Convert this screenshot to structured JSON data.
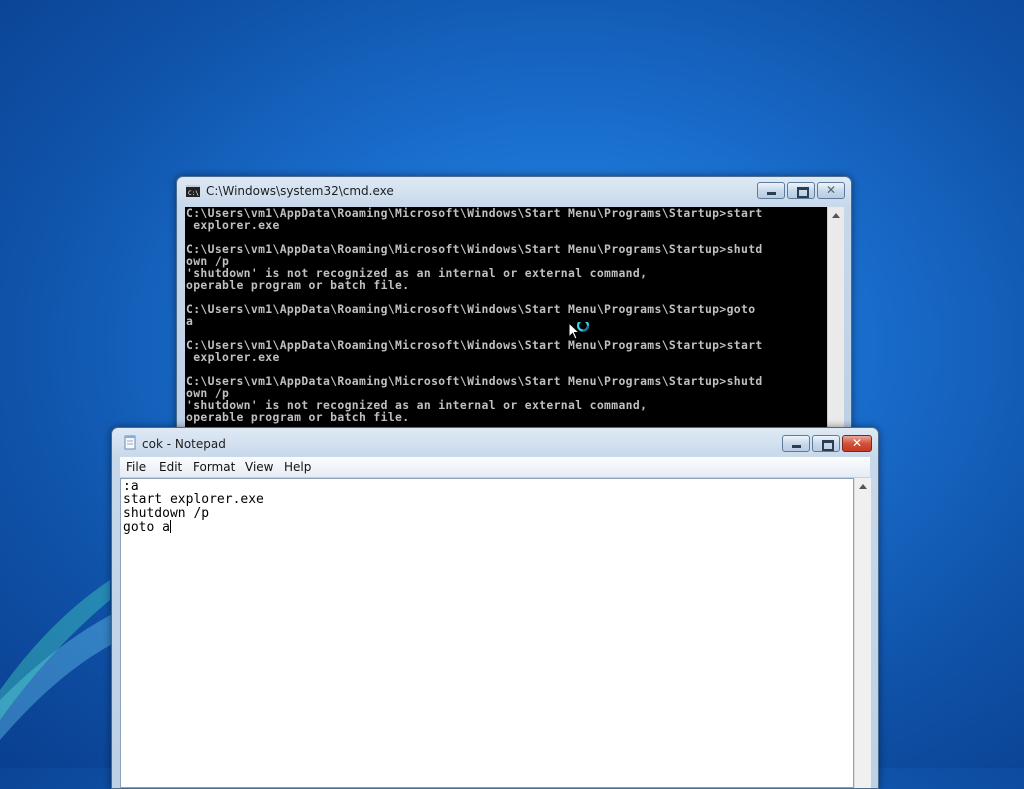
{
  "cmd": {
    "title": "C:\\Windows\\system32\\cmd.exe",
    "lines": "C:\\Users\\vm1\\AppData\\Roaming\\Microsoft\\Windows\\Start Menu\\Programs\\Startup>start\n explorer.exe\n\nC:\\Users\\vm1\\AppData\\Roaming\\Microsoft\\Windows\\Start Menu\\Programs\\Startup>shutd\nown /p\n'shutdown' is not recognized as an internal or external command,\noperable program or batch file.\n\nC:\\Users\\vm1\\AppData\\Roaming\\Microsoft\\Windows\\Start Menu\\Programs\\Startup>goto\na\n\nC:\\Users\\vm1\\AppData\\Roaming\\Microsoft\\Windows\\Start Menu\\Programs\\Startup>start\n explorer.exe\n\nC:\\Users\\vm1\\AppData\\Roaming\\Microsoft\\Windows\\Start Menu\\Programs\\Startup>shutd\nown /p\n'shutdown' is not recognized as an internal or external command,\noperable program or batch file.",
    "close_glyph": "✕"
  },
  "notepad": {
    "title": "cok - Notepad",
    "menu": [
      "File",
      "Edit",
      "Format",
      "View",
      "Help"
    ],
    "content": ":a\nstart explorer.exe\nshutdown /p\ngoto a",
    "close_glyph": "✕"
  },
  "colors": {
    "desktop": "#1a6fcf",
    "console_bg": "#000000",
    "console_text": "#c0c0c0",
    "close_button": "#c43a23"
  }
}
